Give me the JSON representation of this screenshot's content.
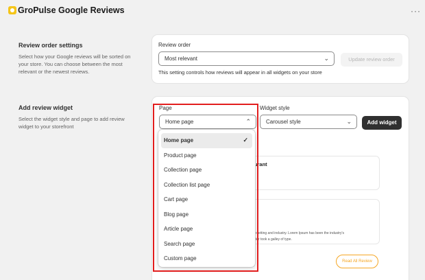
{
  "app": {
    "title": "GroPulse Google Reviews",
    "logo": "app-logo",
    "more": "···"
  },
  "review_order": {
    "heading": "Review order settings",
    "description": "Select how your Google reviews will be sorted on your store. You can choose between the most relevant or the newest reviews.",
    "field_label": "Review order",
    "selected": "Most relevant",
    "update_button": "Update review order",
    "help": "This setting controls how reviews will appear in all widgets on your store"
  },
  "add_widget": {
    "heading": "Add review widget",
    "description": "Select the widget style and page to add review widget to your storefront",
    "page_label": "Page",
    "page_selected": "Home page",
    "style_label": "Widget style",
    "style_selected": "Carousel style",
    "add_button": "Add widget"
  },
  "dropdown": {
    "options": [
      "Home page",
      "Product page",
      "Collection page",
      "Collection list page",
      "Cart page",
      "Blog page",
      "Article page",
      "Search page",
      "Custom page"
    ],
    "selected_index": 0,
    "check": "✓"
  },
  "preview": {
    "card1_title": "& Restaurant",
    "card2_line1": "nting and typesetting and industry. Lorem Ipsum has been the industry's",
    "card2_line2": "unknown printer took a galley of type.",
    "read_all": "Read All Review"
  },
  "colors": {
    "accent_dark": "#303030",
    "highlight": "#e21d1d",
    "review_link": "#f5a623"
  }
}
